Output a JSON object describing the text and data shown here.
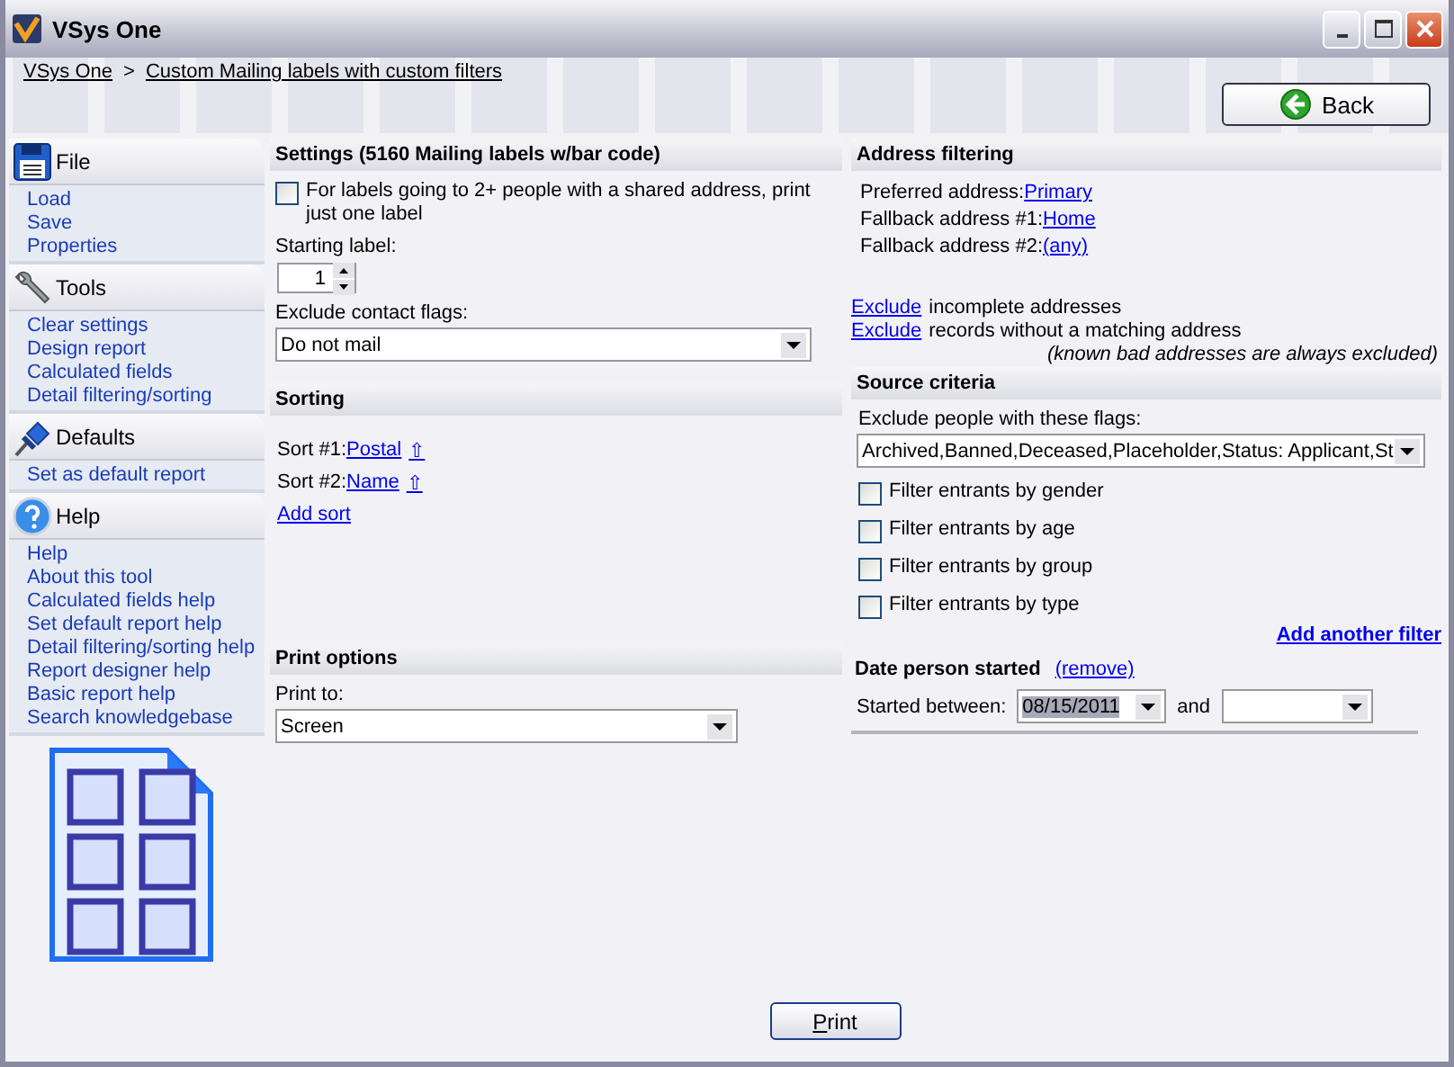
{
  "window": {
    "title": "VSys One"
  },
  "breadcrumb": {
    "items": [
      "VSys One",
      "Custom Mailing labels with custom filters"
    ],
    "separator": ">"
  },
  "back_button": "Back",
  "sidebar": [
    {
      "kind": "file",
      "title": "File",
      "items": [
        "Load",
        "Save",
        "Properties"
      ]
    },
    {
      "kind": "tools",
      "title": "Tools",
      "items": [
        "Clear settings",
        "Design report",
        "Calculated fields",
        "Detail filtering/sorting"
      ]
    },
    {
      "kind": "defaults",
      "title": "Defaults",
      "items": [
        "Set as default report"
      ]
    },
    {
      "kind": "help",
      "title": "Help",
      "items": [
        "Help",
        "About this tool",
        "Calculated fields help",
        "Set default report help",
        "Detail filtering/sorting help",
        "Report designer help",
        "Basic report help",
        "Search knowledgebase"
      ]
    }
  ],
  "settings": {
    "title": "Settings (5160 Mailing labels w/bar code)",
    "checkbox": {
      "label": "For labels going to 2+ people with a shared address, print just one label",
      "checked": false
    },
    "starting_label": {
      "label": "Starting label:",
      "value": "1"
    },
    "exclude_flags": {
      "label": "Exclude contact flags:",
      "value": "Do not mail"
    }
  },
  "sorting": {
    "title": "Sorting",
    "sorts": [
      {
        "label": "Sort #1:",
        "field": "Postal",
        "direction": "⇧"
      },
      {
        "label": "Sort #2:",
        "field": "Name",
        "direction": "⇧"
      }
    ],
    "add_link": "Add sort"
  },
  "print_options": {
    "title": "Print options",
    "label": "Print to:",
    "value": "Screen"
  },
  "address_filtering": {
    "title": "Address filtering",
    "rows": [
      {
        "label": "Preferred address:",
        "value": "Primary"
      },
      {
        "label": "Fallback address #1:",
        "value": "Home"
      },
      {
        "label": "Fallback address #2:",
        "value": "(any)"
      }
    ],
    "excludes": [
      {
        "link": "Exclude",
        "text": "incomplete addresses"
      },
      {
        "link": "Exclude",
        "text": "records without a matching address"
      }
    ],
    "note": "(known bad addresses are always excluded)"
  },
  "source_criteria": {
    "title": "Source criteria",
    "flags_label": "Exclude people with these flags:",
    "flags_value": "Archived,Banned,Deceased,Placeholder,Status: Applicant,St",
    "filters": [
      {
        "label": "Filter entrants by gender",
        "checked": false
      },
      {
        "label": "Filter entrants by age",
        "checked": false
      },
      {
        "label": "Filter entrants by group",
        "checked": false
      },
      {
        "label": "Filter entrants by type",
        "checked": false
      }
    ],
    "add_filter": "Add another filter"
  },
  "date_filter": {
    "title": "Date person started",
    "remove": "(remove)",
    "label": "Started between:",
    "from": {
      "value": "08/15/2011",
      "highlighted": true
    },
    "and": "and"
  },
  "print_button": "Print"
}
